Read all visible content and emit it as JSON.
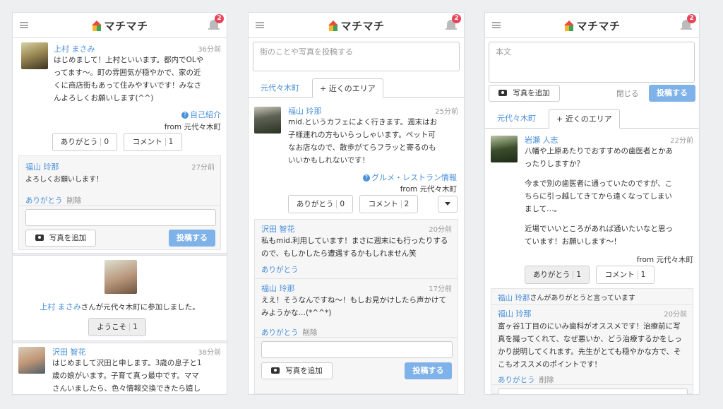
{
  "app": {
    "logo": "マチマチ",
    "notif_count": "2"
  },
  "p1": {
    "post1": {
      "name": "上村 まさみ",
      "time": "36分前",
      "lines": [
        "はじめまして！上村といいます。都内でOLや",
        "ってます〜。町の雰囲気が穏やかで、家の近",
        "くに商店街もあって住みやすいです！みなさ",
        "んよろしくお願いします(^^)"
      ],
      "category": "自己紹介",
      "from": "from 元代々木町",
      "thanks": "ありがとう",
      "thanks_count": "0",
      "comment": "コメント",
      "comment_count": "1"
    },
    "comment1": {
      "name": "福山 玲那",
      "time": "27分前",
      "text": "よろしくお願いします！",
      "thanks": "ありがとう",
      "delete": "削除"
    },
    "photo_btn": "写真を追加",
    "submit": "投稿する",
    "join": {
      "name": "上村 まさみ",
      "text": "さんが元代々木町に参加しました。",
      "welcome": "ようこそ",
      "welcome_count": "1"
    },
    "post2": {
      "name": "沢田 智花",
      "time": "38分前",
      "lines": [
        "はじめまして沢田と申します。3歳の息子と1",
        "歳の娘がいます。子育て真っ最中です。ママ",
        "さんいましたら、色々情報交換できたら嬉し"
      ]
    }
  },
  "p2": {
    "placeholder": "街のことや写真を投稿する",
    "tab1": "元代々木町",
    "tab2": "+ 近くのエリア",
    "post": {
      "name": "福山 玲那",
      "time": "25分前",
      "lines": [
        "mid.というカフェによく行きます。週末はお",
        "子様連れの方もいらっしゃいます。ペット可",
        "なお店なので、散歩がてらフラッと寄るのも",
        "いいかもしれないです！"
      ],
      "category": "グルメ・レストラン情報",
      "from": "from 元代々木町",
      "thanks": "ありがとう",
      "thanks_count": "0",
      "comment": "コメント",
      "comment_count": "2"
    },
    "comment1": {
      "name": "沢田 智花",
      "time": "20分前",
      "lines": [
        "私もmid.利用しています！まさに週末にも行ったりする",
        "ので、もしかしたら遭遇するかもしれません笑"
      ],
      "thanks": "ありがとう"
    },
    "comment2": {
      "name": "福山 玲那",
      "time": "17分前",
      "lines": [
        "ええ！そうなんですね〜！もしお見かけしたら声かけて",
        "みようかな…(*^^*)"
      ],
      "thanks": "ありがとう",
      "delete": "削除"
    },
    "photo_btn": "写真を追加",
    "submit": "投稿する"
  },
  "p3": {
    "placeholder": "本文",
    "photo_btn": "写真を追加",
    "close": "閉じる",
    "submit": "投稿する",
    "tab1": "元代々木町",
    "tab2": "+ 近くのエリア",
    "post": {
      "name": "岩瀬 人志",
      "time": "22分前",
      "lines": [
        "八幡や上原あたりでおすすめの歯医者とかあ",
        "ったりしますか？",
        "",
        "今まで別の歯医者に通っていたのですが、こ",
        "ちらに引っ越してきてから遠くなってしまい",
        "まして…。",
        "",
        "近場でいいところがあれば通いたいなと思っ",
        "ています！お願いします〜！"
      ],
      "from": "from 元代々木町",
      "thanks": "ありがとう",
      "thanks_count": "1",
      "comment": "コメント",
      "comment_count": "1"
    },
    "thanked": {
      "name": "福山 玲那",
      "text": "さんがありがとうと言っています"
    },
    "comment1": {
      "name": "福山 玲那",
      "time": "20分前",
      "lines": [
        "富ヶ谷1丁目のにいみ歯科がオススメです！治療前に写",
        "真を撮ってくれて、なぜ悪いか、どう治療するかをしっ",
        "かり説明してくれます。先生がとても穏やかな方で、そ",
        "こもオススメのポイントです！"
      ],
      "thanks": "ありがとう",
      "delete": "削除"
    }
  }
}
